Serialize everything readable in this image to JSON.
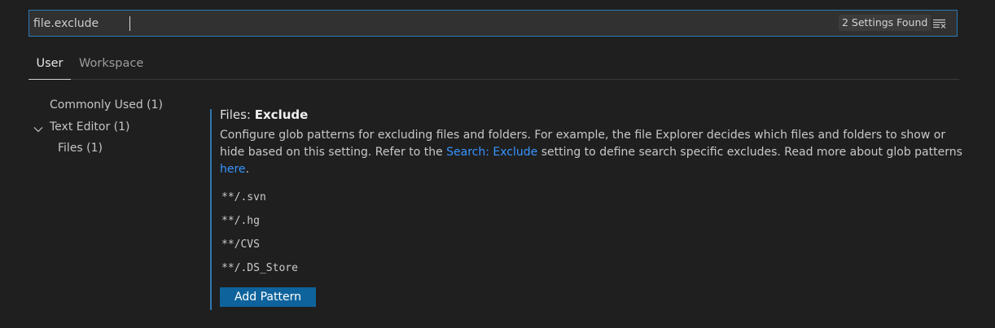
{
  "search": {
    "value": "file.exclude",
    "results_badge": "2 Settings Found",
    "clear_icon": "clear-filter-icon"
  },
  "tabs": [
    {
      "label": "User",
      "active": true
    },
    {
      "label": "Workspace",
      "active": false
    }
  ],
  "toc": {
    "items": [
      {
        "label": "Commonly Used (1)"
      },
      {
        "label": "Text Editor (1)",
        "expanded": true,
        "icon": "chevron-down-icon"
      },
      {
        "label": "Files (1)"
      }
    ]
  },
  "setting": {
    "category": "Files: ",
    "name": "Exclude",
    "description_part1": "Configure glob patterns for excluding files and folders. For example, the file Explorer decides which files and folders to show or hide based on this setting. Refer to the ",
    "link1": "Search: Exclude",
    "description_part2": " setting to define search specific excludes. Read more about glob patterns ",
    "link2": "here",
    "description_part3": ".",
    "patterns": [
      "**/.svn",
      "**/.hg",
      "**/CVS",
      "**/.DS_Store"
    ],
    "add_button": "Add Pattern"
  },
  "colors": {
    "background": "#1f1f1f",
    "accent": "#0e639c",
    "link": "#3794ff",
    "focus_border": "#2b79b8"
  }
}
